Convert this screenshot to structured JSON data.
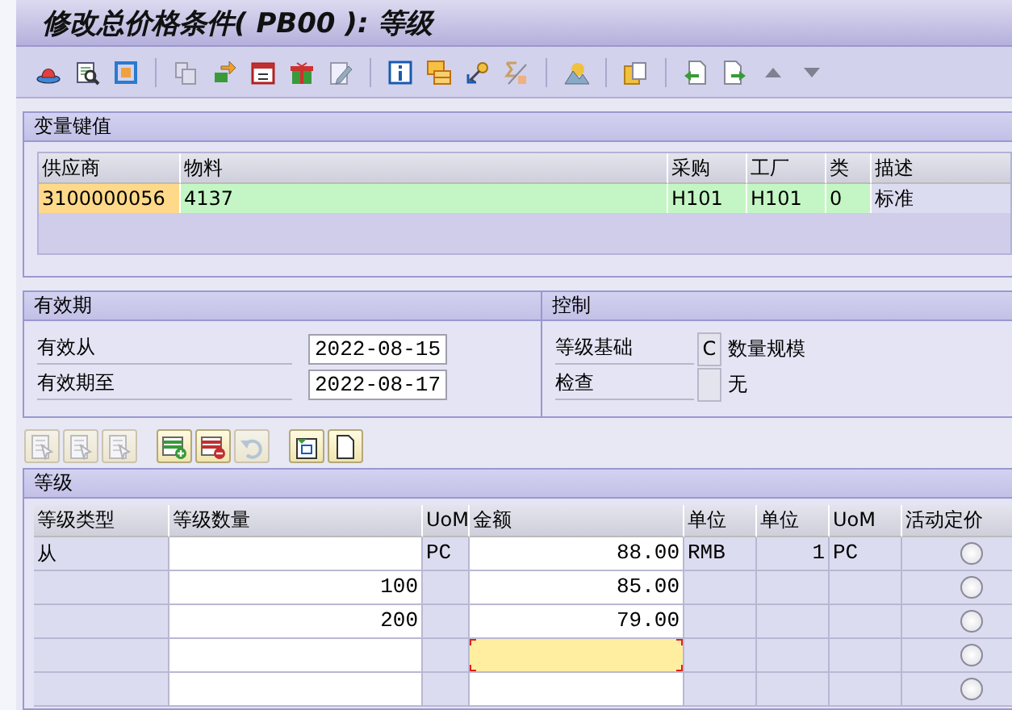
{
  "window": {
    "title": "修改总价格条件( PB00 ): 等级"
  },
  "key_panel": {
    "title": "变量键值",
    "columns": [
      {
        "label": "供应商",
        "kind": "key"
      },
      {
        "label": "物料",
        "kind": "data"
      },
      {
        "label": "采购",
        "kind": "data"
      },
      {
        "label": "工厂",
        "kind": "data"
      },
      {
        "label": "类",
        "kind": "data"
      },
      {
        "label": "描述",
        "kind": "text"
      }
    ],
    "rows": [
      [
        "3100000056",
        "4137",
        "H101",
        "H101",
        "0",
        "标准"
      ]
    ]
  },
  "validity": {
    "title": "有效期",
    "fields": [
      {
        "label": "有效从",
        "value": "2022-08-15"
      },
      {
        "label": "有效期至",
        "value": "2022-08-17"
      }
    ]
  },
  "control": {
    "title": "控制",
    "fields": [
      {
        "label": "等级基础",
        "code": "C",
        "text": "数量规模"
      },
      {
        "label": "检查",
        "text": "无"
      }
    ]
  },
  "scales": {
    "title": "等级",
    "columns": [
      {
        "label": "等级类型",
        "kind": "text"
      },
      {
        "label": "等级数量",
        "kind": "input"
      },
      {
        "label": "UoM",
        "kind": "text"
      },
      {
        "label": "金额",
        "kind": "input"
      },
      {
        "label": "单位",
        "kind": "text"
      },
      {
        "label": "单位",
        "kind": "number"
      },
      {
        "label": "UoM",
        "kind": "text"
      },
      {
        "label": "活动定价",
        "kind": "radio"
      }
    ],
    "rows": [
      {
        "scale_type": "从",
        "uom": "PC",
        "amount": "88.00",
        "unit": "RMB",
        "per": "1",
        "per_uom": "PC",
        "active_pricing": {
          "selected": false
        },
        "focused": false
      },
      {
        "quantity": "100",
        "amount": "85.00",
        "active_pricing": {
          "selected": false
        },
        "focused": false
      },
      {
        "quantity": "200",
        "amount": "79.00",
        "active_pricing": {
          "selected": false
        },
        "focused": false
      },
      {
        "active_pricing": {
          "selected": false
        },
        "focused": true
      },
      {
        "active_pricing": {
          "selected": false
        },
        "focused": false
      }
    ]
  }
}
